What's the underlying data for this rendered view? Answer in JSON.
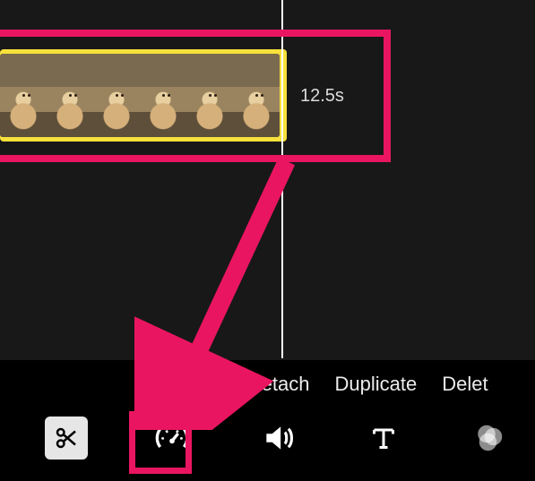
{
  "clip": {
    "duration_label": "12.5s"
  },
  "toolbar": {
    "actions": {
      "split": "Split",
      "detach": "Detach",
      "duplicate": "Duplicate",
      "delete": "Delet"
    }
  },
  "annotations": {
    "highlight_color": "#ea1560"
  }
}
